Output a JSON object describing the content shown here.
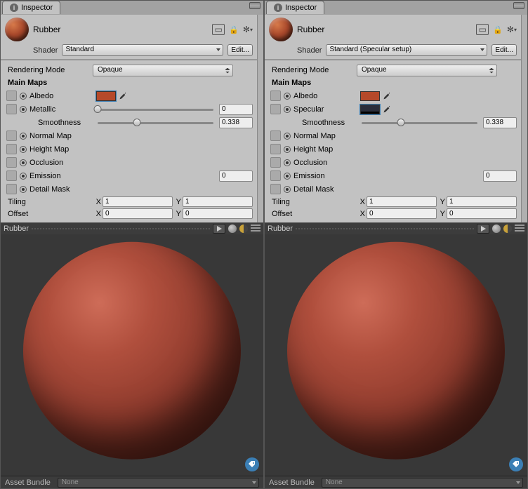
{
  "panels": [
    {
      "tab": "Inspector",
      "material_name": "Rubber",
      "shader_label": "Shader",
      "shader_value": "Standard",
      "edit_label": "Edit...",
      "rendering_mode_label": "Rendering Mode",
      "rendering_mode_value": "Opaque",
      "main_maps_label": "Main Maps",
      "maps": {
        "albedo": {
          "label": "Albedo",
          "color": "#b5492a",
          "selected": true
        },
        "metallic": {
          "label": "Metallic",
          "slider_value": 0,
          "slider_field": "0"
        },
        "specular": null,
        "smoothness": {
          "label": "Smoothness",
          "slider_value": 0.338,
          "slider_field": "0.338"
        },
        "normal": {
          "label": "Normal Map"
        },
        "height": {
          "label": "Height Map"
        },
        "occlusion": {
          "label": "Occlusion"
        },
        "emission": {
          "label": "Emission",
          "field": "0"
        },
        "detail": {
          "label": "Detail Mask"
        }
      },
      "tiling": {
        "label": "Tiling",
        "x": "1",
        "y": "1"
      },
      "offset": {
        "label": "Offset",
        "x": "0",
        "y": "0"
      },
      "preview_name": "Rubber",
      "footer_label": "Asset Bundle",
      "footer_value": "None"
    },
    {
      "tab": "Inspector",
      "material_name": "Rubber",
      "shader_label": "Shader",
      "shader_value": "Standard (Specular setup)",
      "edit_label": "Edit...",
      "rendering_mode_label": "Rendering Mode",
      "rendering_mode_value": "Opaque",
      "main_maps_label": "Main Maps",
      "maps": {
        "albedo": {
          "label": "Albedo",
          "color": "#b5492a",
          "selected": false
        },
        "metallic": null,
        "specular": {
          "label": "Specular",
          "color": "#2a2d3a",
          "selected": true
        },
        "smoothness": {
          "label": "Smoothness",
          "slider_value": 0.338,
          "slider_field": "0.338"
        },
        "normal": {
          "label": "Normal Map"
        },
        "height": {
          "label": "Height Map"
        },
        "occlusion": {
          "label": "Occlusion"
        },
        "emission": {
          "label": "Emission",
          "field": "0"
        },
        "detail": {
          "label": "Detail Mask"
        }
      },
      "tiling": {
        "label": "Tiling",
        "x": "1",
        "y": "1"
      },
      "offset": {
        "label": "Offset",
        "x": "0",
        "y": "0"
      },
      "preview_name": "Rubber",
      "footer_label": "Asset Bundle",
      "footer_value": "None"
    }
  ]
}
